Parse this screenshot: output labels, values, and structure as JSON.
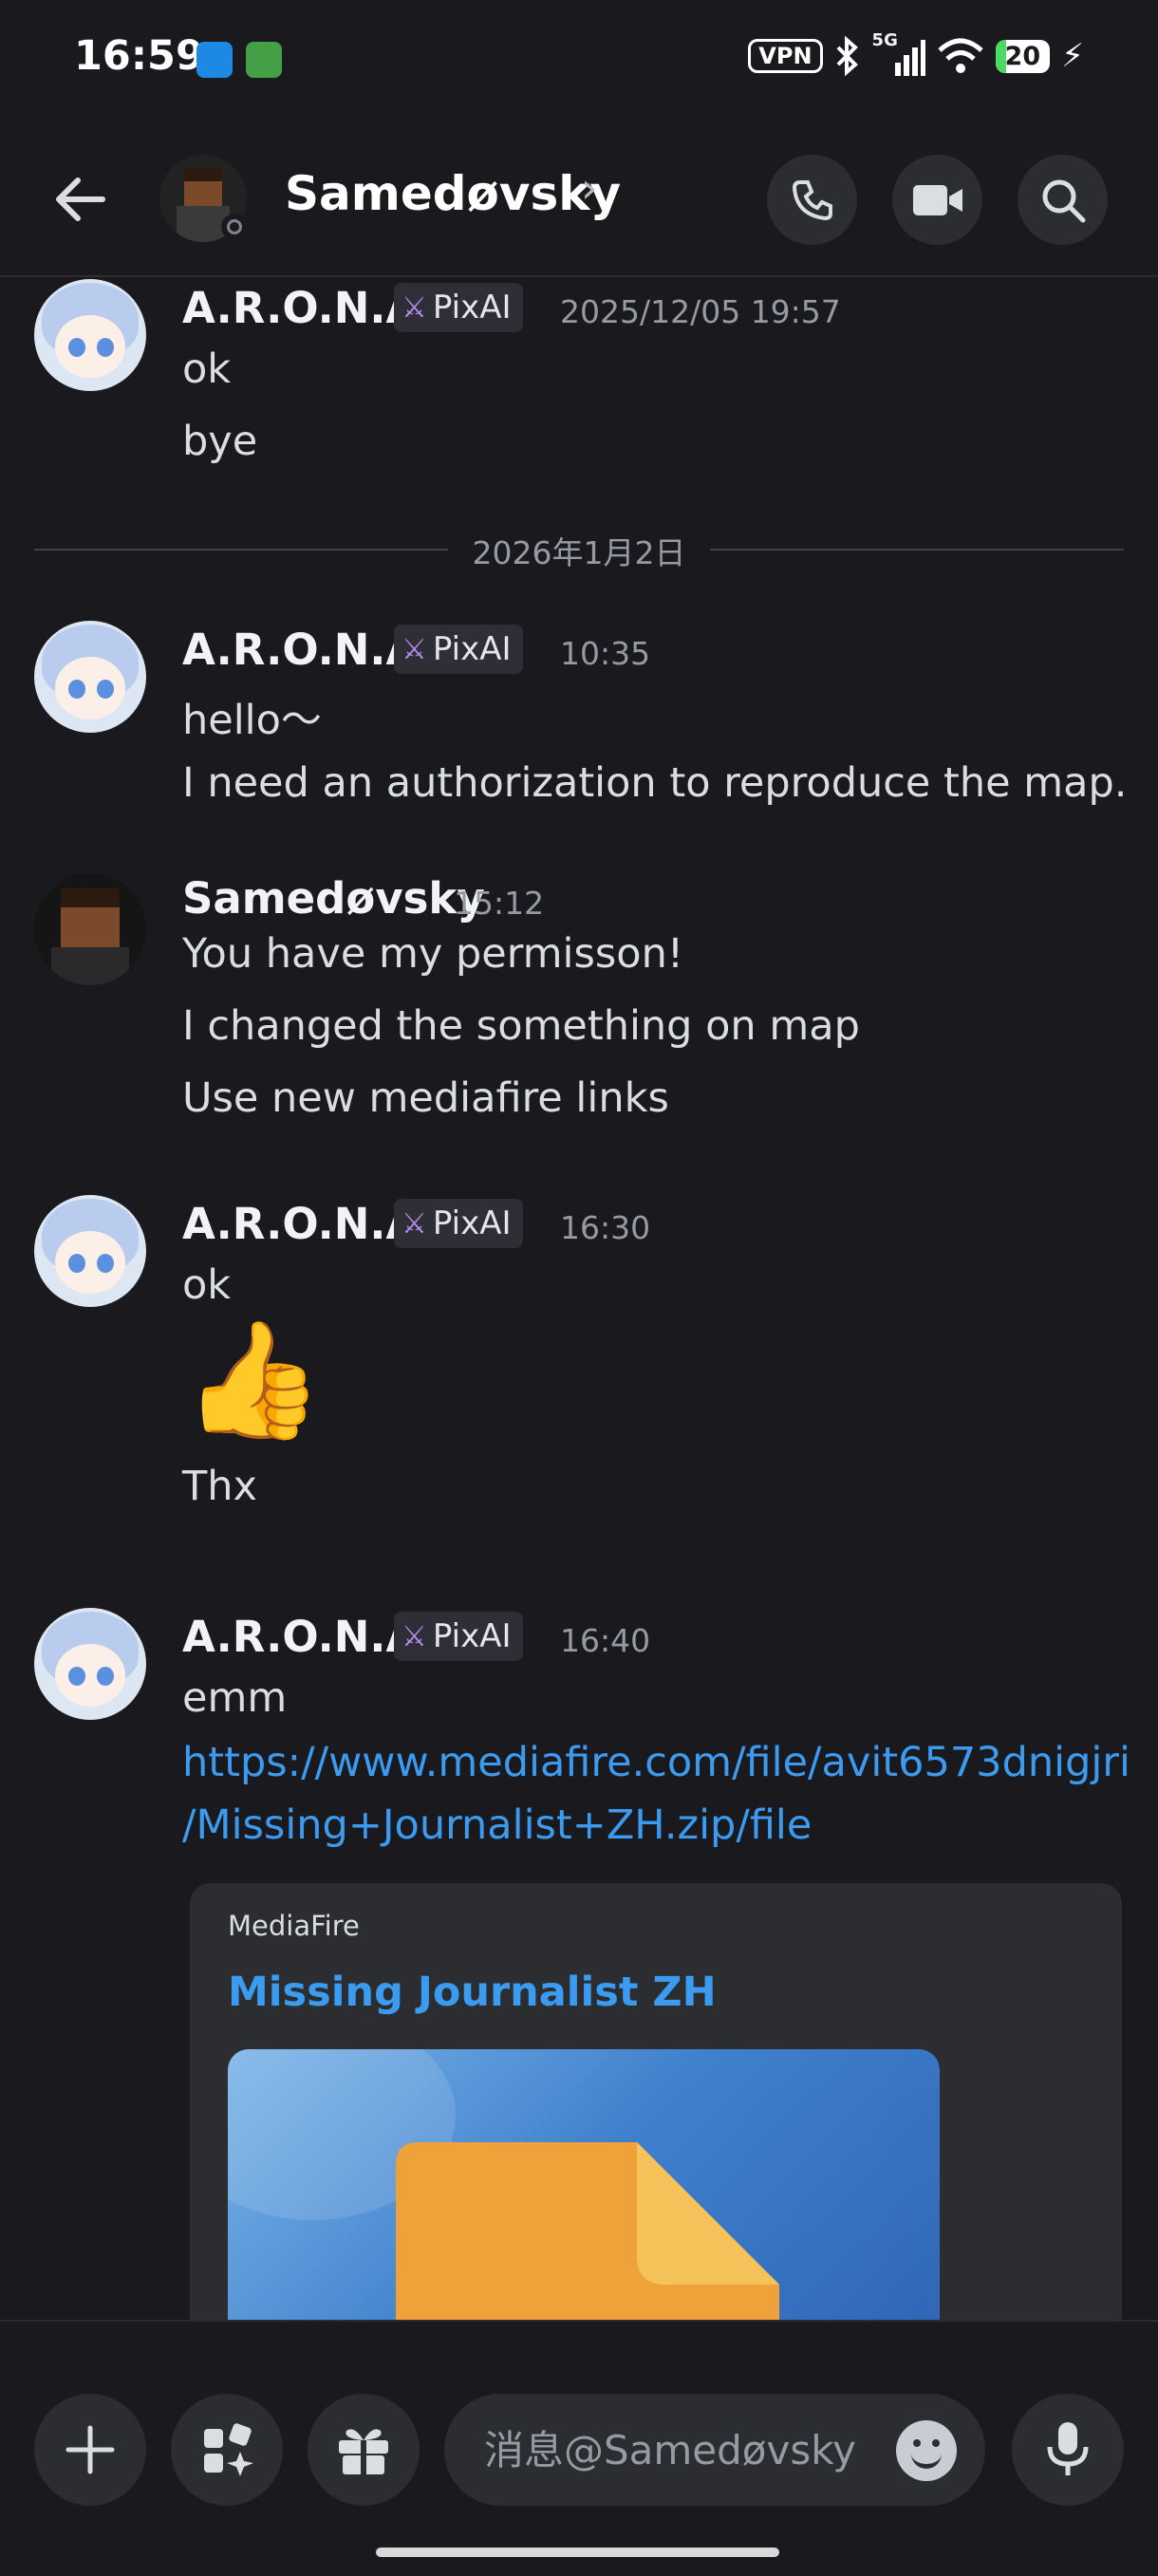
{
  "status_bar": {
    "time": "16:59",
    "vpn": "VPN",
    "network": "5G",
    "battery": "20",
    "battery_level": 0.2
  },
  "header": {
    "contact_name": "Samedøvsky",
    "chevron": "›"
  },
  "colors": {
    "background": "#1a1a1e",
    "surface": "#2b2d31",
    "link": "#3b9bf1",
    "muted": "#949ba4",
    "tag_icon": "#b48ded"
  },
  "messages": [
    {
      "author": "A.R.O.N.A",
      "tag": "PixAI",
      "time": "2025/12/05 19:57",
      "lines": [
        "ok",
        "bye"
      ]
    },
    {
      "divider": "2026年1月2日"
    },
    {
      "author": "A.R.O.N.A",
      "tag": "PixAI",
      "time": "10:35",
      "lines": [
        "hello～",
        "I need an authorization to reproduce the map."
      ]
    },
    {
      "author": "Samedøvsky",
      "time": "15:12",
      "lines": [
        "You have my permisson!",
        "I changed the something on map",
        "Use new mediafire links"
      ]
    },
    {
      "author": "A.R.O.N.A",
      "tag": "PixAI",
      "time": "16:30",
      "lines": [
        "ok",
        "👍",
        "Thx"
      ]
    },
    {
      "author": "A.R.O.N.A",
      "tag": "PixAI",
      "time": "16:40",
      "lines": [
        "emm"
      ],
      "link_lines": [
        "https://www.mediafire.com/file/avit6573dnigjri",
        "/Missing+Journalist+ZH.zip/file"
      ],
      "embed": {
        "provider": "MediaFire",
        "title": "Missing Journalist ZH"
      }
    }
  ],
  "composer": {
    "placeholder": "消息@Samedøvsky"
  },
  "icons": [
    "back-arrow-icon",
    "phone-icon",
    "video-camera-icon",
    "search-icon",
    "plus-icon",
    "apps-icon",
    "gift-icon",
    "emoji-icon",
    "microphone-icon",
    "sword-icon",
    "file-icon"
  ]
}
